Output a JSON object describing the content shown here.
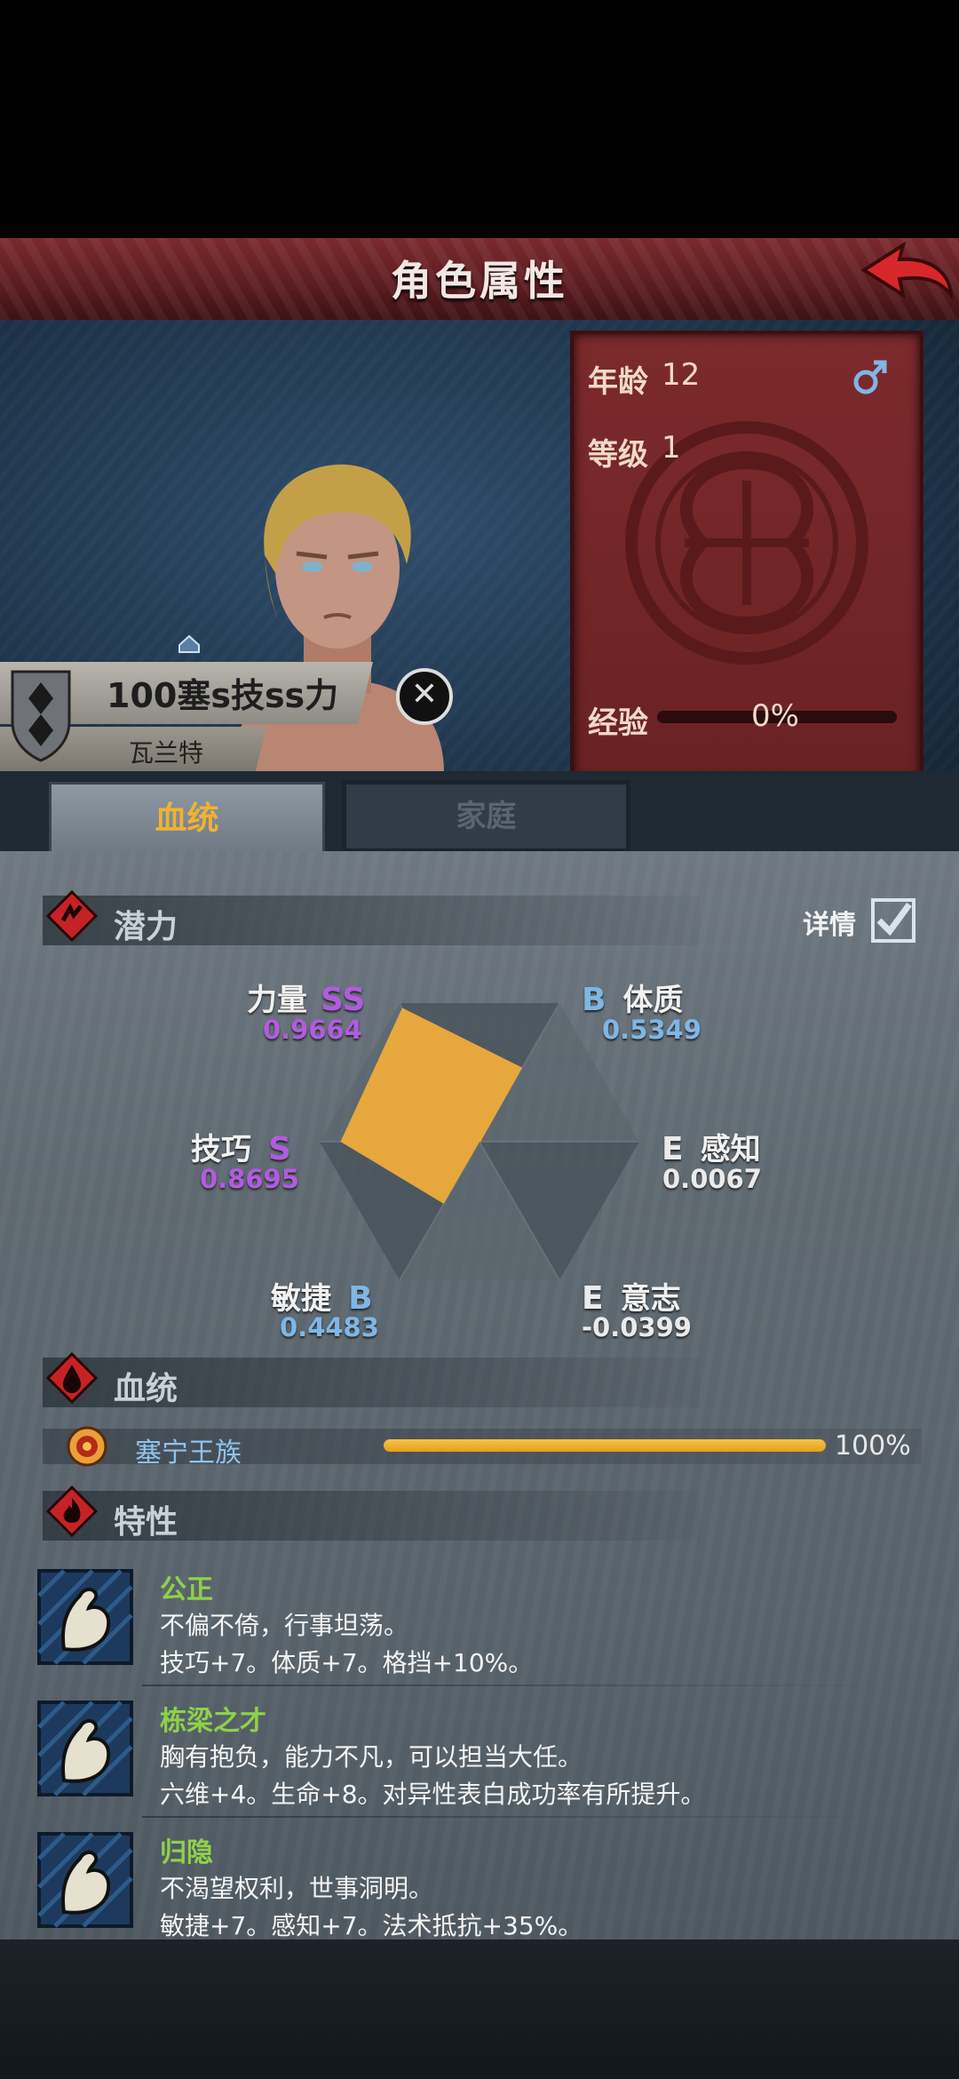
{
  "header": {
    "title": "角色属性"
  },
  "info": {
    "age_label": "年龄",
    "age_value": "12",
    "level_label": "等级",
    "level_value": "1",
    "exp_label": "经验",
    "exp_value": "0%",
    "exp_progress": 0,
    "gender_icon": "male-icon"
  },
  "character": {
    "name": "100塞s技ss力",
    "origin": "瓦兰特"
  },
  "tabs": {
    "bloodline": "血统",
    "family": "家庭",
    "active": "bloodline"
  },
  "potential": {
    "title": "潜力",
    "details_label": "详情",
    "details_checked": true
  },
  "chart_data": {
    "type": "radar",
    "axes": [
      "力量",
      "体质",
      "感知",
      "意志",
      "敏捷",
      "技巧"
    ],
    "grades": [
      "SS",
      "B",
      "E",
      "E",
      "B",
      "S"
    ],
    "values": [
      0.9664,
      0.5349,
      0.0067,
      -0.0399,
      0.4483,
      0.8695
    ],
    "display_values": [
      "0.9664",
      "0.5349",
      "0.0067",
      "-0.0399",
      "0.4483",
      "0.8695"
    ],
    "fill_color": "#eeac3a"
  },
  "bloodline": {
    "title": "血统",
    "name": "塞宁王族",
    "percent_label": "100%",
    "percent": 100
  },
  "traits": {
    "title": "特性",
    "items": [
      {
        "name": "公正",
        "desc": "不偏不倚，行事坦荡。",
        "effect": "技巧+7。体质+7。格挡+10%。"
      },
      {
        "name": "栋梁之才",
        "desc": "胸有抱负，能力不凡，可以担当大任。",
        "effect": "六维+4。生命+8。对异性表白成功率有所提升。"
      },
      {
        "name": "归隐",
        "desc": "不渴望权利，世事洞明。",
        "effect": "敏捷+7。感知+7。法术抵抗+35%。"
      }
    ]
  },
  "colors": {
    "accent_gold": "#f0b233",
    "trait_green": "#8fd14a",
    "grade_purple": "#b05ce0",
    "grade_blue": "#7fb6e6"
  }
}
